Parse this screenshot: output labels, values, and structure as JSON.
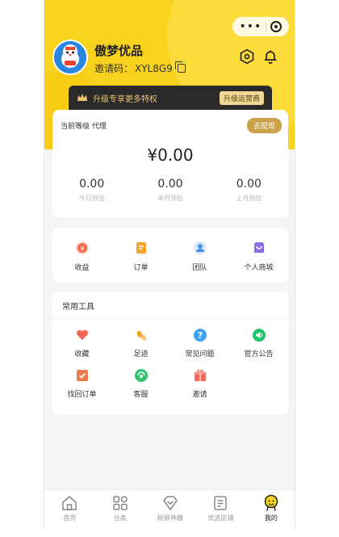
{
  "header": {
    "shop_name": "傲梦优品",
    "invite_label": "邀请码：",
    "invite_code": "XYL8G9"
  },
  "vip_bar": {
    "text": "升级专享更多特权",
    "button_label": "升级运营商"
  },
  "level_card": {
    "level_label": "当前等级 代理",
    "withdraw_button": "去提现",
    "balance": "¥0.00",
    "stats": [
      {
        "value": "0.00",
        "label": "今日预估"
      },
      {
        "value": "0.00",
        "label": "本月预估"
      },
      {
        "value": "0.00",
        "label": "上月预估"
      }
    ]
  },
  "quick_menu": [
    {
      "label": "收益",
      "icon": "income-icon",
      "color": "#f26b4e"
    },
    {
      "label": "订单",
      "icon": "orders-icon",
      "color": "#f4a52d"
    },
    {
      "label": "团队",
      "icon": "team-icon",
      "color": "#4a90e2"
    },
    {
      "label": "个人商城",
      "icon": "shop-icon",
      "color": "#8b6ee8"
    }
  ],
  "tools": {
    "title": "常用工具",
    "items": [
      {
        "label": "收藏",
        "icon": "favorite-icon",
        "color": "#f2665a"
      },
      {
        "label": "足迹",
        "icon": "footprint-icon",
        "color": "#f4a52d"
      },
      {
        "label": "常见问题",
        "icon": "faq-icon",
        "color": "#3aa3f0"
      },
      {
        "label": "官方公告",
        "icon": "announcement-icon",
        "color": "#1cc46b"
      },
      {
        "label": "找回订单",
        "icon": "recover-order-icon",
        "color": "#f07a4a"
      },
      {
        "label": "客服",
        "icon": "customer-service-icon",
        "color": "#2fc36a"
      },
      {
        "label": "邀请",
        "icon": "invite-icon",
        "color": "#f2665a"
      }
    ]
  },
  "tabbar": [
    {
      "label": "首页",
      "icon": "home-icon"
    },
    {
      "label": "分类",
      "icon": "category-icon"
    },
    {
      "label": "刷屏神器",
      "icon": "diamond-icon"
    },
    {
      "label": "优选店铺",
      "icon": "store-icon"
    },
    {
      "label": "我的",
      "icon": "profile-icon",
      "active": true
    }
  ]
}
